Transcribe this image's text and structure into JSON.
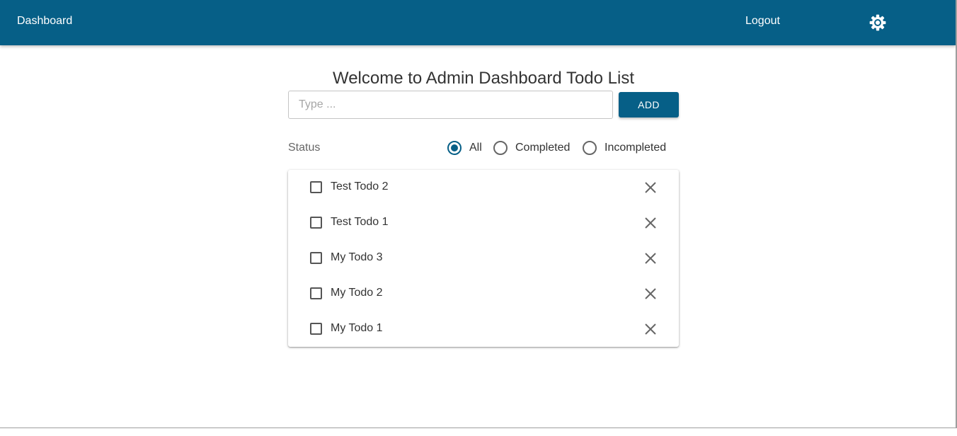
{
  "appbar": {
    "brand": "Dashboard",
    "logout": "Logout",
    "settings_icon": "settings-gear-icon",
    "background": "#065f87"
  },
  "main": {
    "title": "Welcome to Admin Dashboard Todo List",
    "input": {
      "placeholder": "Type ...",
      "value": ""
    },
    "add_label": "ADD",
    "status": {
      "label": "Status",
      "options": [
        "All",
        "Completed",
        "Incompleted"
      ],
      "selected": "All"
    },
    "todos": [
      {
        "text": "Test Todo 2",
        "completed": false
      },
      {
        "text": "Test Todo 1",
        "completed": false
      },
      {
        "text": "My Todo 3",
        "completed": false
      },
      {
        "text": "My Todo 2",
        "completed": false
      },
      {
        "text": "My Todo 1",
        "completed": false
      }
    ]
  },
  "colors": {
    "primary": "#065f87",
    "text": "#333333",
    "muted": "#666666"
  }
}
